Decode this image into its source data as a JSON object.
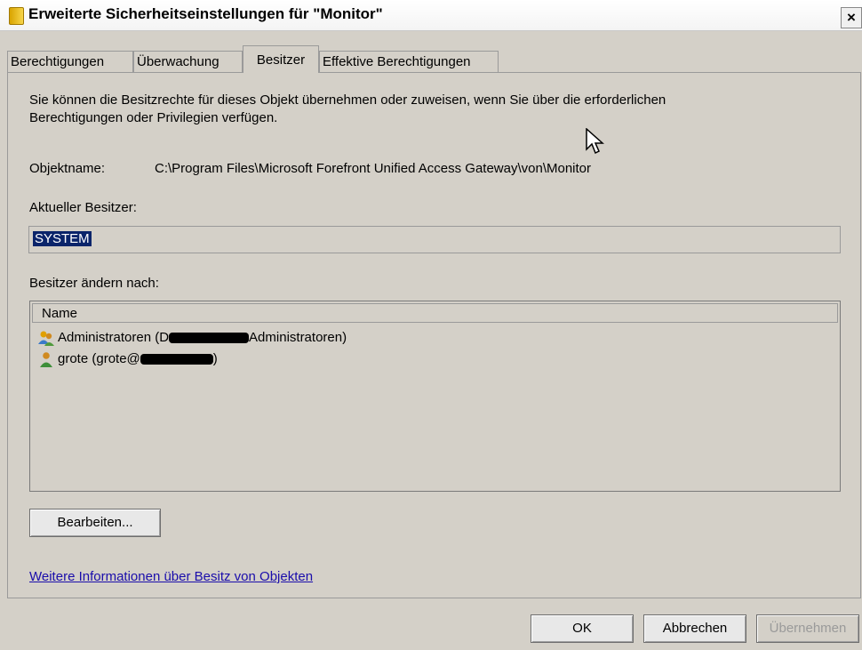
{
  "window": {
    "title": "Erweiterte Sicherheitseinstellungen für \"Monitor\"",
    "close_label": "×"
  },
  "tabs": [
    {
      "label": "Berechtigungen"
    },
    {
      "label": "Überwachung"
    },
    {
      "label": "Besitzer"
    },
    {
      "label": "Effektive Berechtigungen"
    }
  ],
  "owner_page": {
    "description_line1": "Sie können die Besitzrechte für dieses Objekt übernehmen oder zuweisen, wenn Sie über die erforderlichen",
    "description_line2": "Berechtigungen oder Privilegien verfügen.",
    "object_name_label": "Objektname:",
    "object_name_value": "C:\\Program Files\\Microsoft Forefront Unified Access Gateway\\von\\Monitor",
    "current_owner_label": "Aktueller Besitzer:",
    "current_owner_value": "SYSTEM",
    "change_owner_label": "Besitzer ändern nach:",
    "list_column": "Name",
    "list_items": [
      {
        "prefix": "Administratoren (D",
        "suffix": "Administratoren)",
        "icon": "group-icon"
      },
      {
        "prefix": "grote (grote@",
        "suffix": ")",
        "icon": "user-icon"
      }
    ],
    "edit_button": "Bearbeiten...",
    "help_link": "Weitere Informationen über Besitz von Objekten"
  },
  "footer": {
    "ok": "OK",
    "cancel": "Abbrechen",
    "apply": "Übernehmen"
  },
  "colors": {
    "dialog_bg": "#d4d0c8",
    "selection_bg": "#0a246a",
    "link": "#1a0dab"
  }
}
